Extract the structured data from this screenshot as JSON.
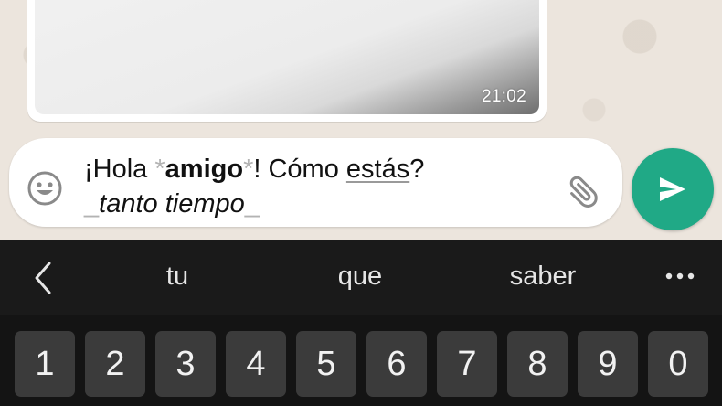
{
  "chat": {
    "media_time": "21:02"
  },
  "composer": {
    "text": {
      "line1_prefix": "¡Hola ",
      "bold_open": "*",
      "bold_word": "amigo",
      "bold_close": "*",
      "line1_middle": "! Cómo ",
      "underlined_word": "estás",
      "line1_suffix": "?",
      "italic_open": "_",
      "italic_phrase": "tanto tiempo",
      "italic_close": "_"
    },
    "emoji_icon": "smiley-face-icon",
    "attach_icon": "paperclip-icon"
  },
  "send_button": {
    "icon": "send-arrow-icon",
    "color": "#20a986"
  },
  "keyboard": {
    "suggestions": [
      "tu",
      "que",
      "saber"
    ],
    "back_icon": "chevron-left-icon",
    "more_icon": "more-dots-icon",
    "number_keys": [
      "1",
      "2",
      "3",
      "4",
      "5",
      "6",
      "7",
      "8",
      "9",
      "0"
    ]
  }
}
